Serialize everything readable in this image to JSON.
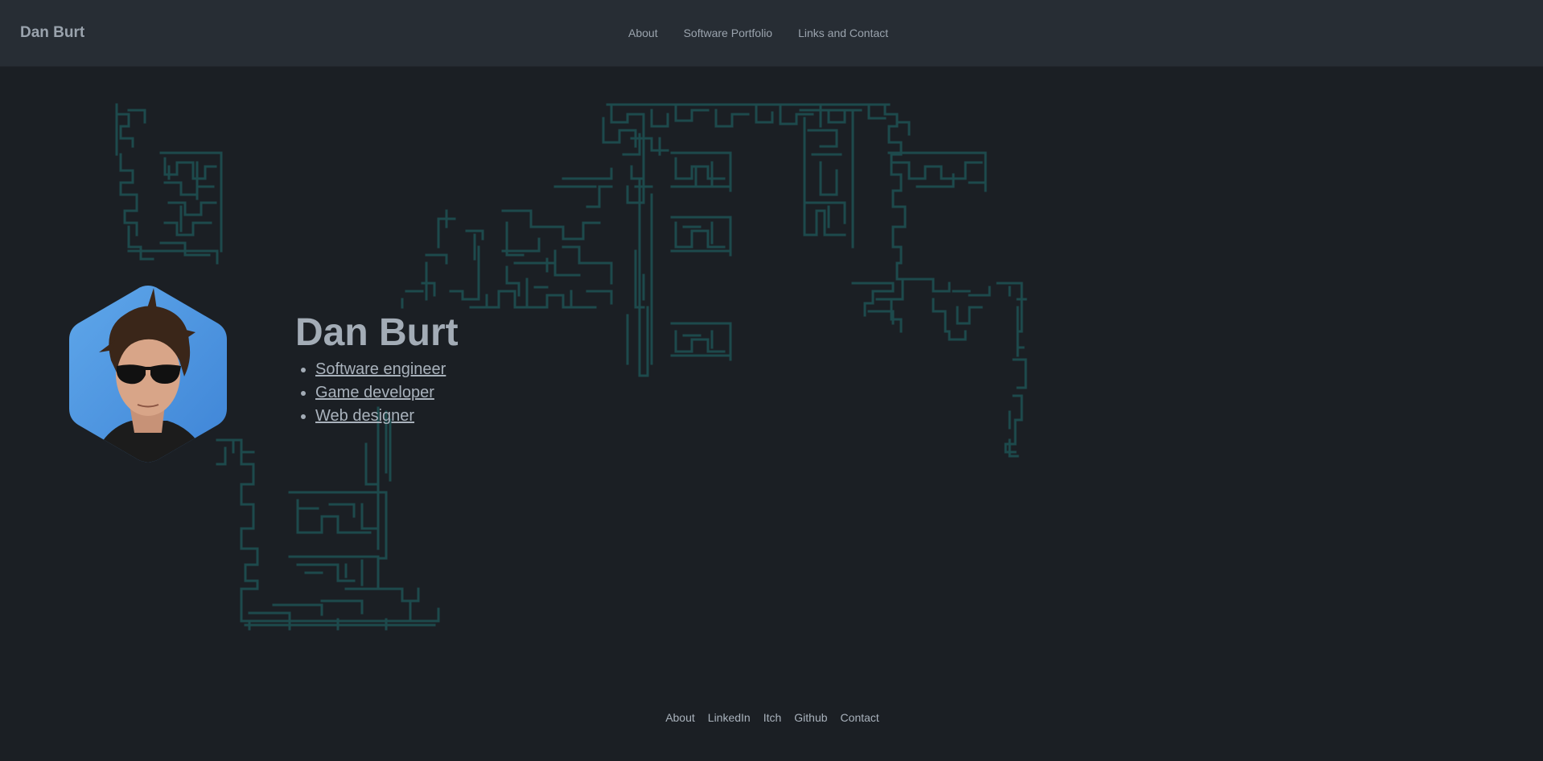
{
  "header": {
    "brand": "Dan Burt",
    "nav": [
      {
        "label": "About"
      },
      {
        "label": "Software Portfolio"
      },
      {
        "label": "Links and Contact"
      }
    ]
  },
  "hero": {
    "name": "Dan Burt",
    "roles": [
      {
        "label": "Software engineer"
      },
      {
        "label": "Game developer"
      },
      {
        "label": "Web designer"
      }
    ]
  },
  "footer": {
    "links": [
      {
        "label": "About"
      },
      {
        "label": "LinkedIn"
      },
      {
        "label": "Itch"
      },
      {
        "label": "Github"
      },
      {
        "label": "Contact"
      }
    ]
  },
  "colors": {
    "background": "#1b1f24",
    "navbar": "#272d34",
    "maze": "#1d4a4c",
    "text": "#a3acb6"
  }
}
